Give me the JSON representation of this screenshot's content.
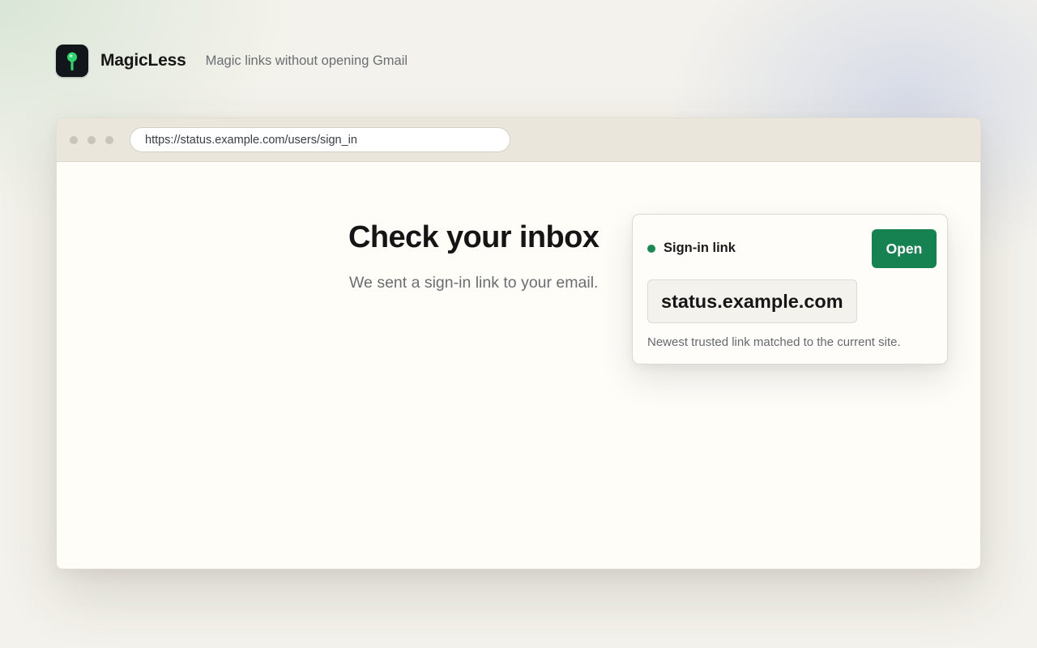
{
  "brand": {
    "name": "MagicLess",
    "tagline": "Magic links without opening Gmail",
    "icon": "key-icon",
    "accent_color": "#2fd470"
  },
  "browser": {
    "url": "https://status.example.com/users/sign_in",
    "window_controls": [
      "close",
      "minimize",
      "maximize"
    ]
  },
  "page": {
    "heading": "Check your inbox",
    "subtext": "We sent a sign-in link to your email."
  },
  "popup": {
    "label": "Sign-in link",
    "status_color": "#1a8a50",
    "open_label": "Open",
    "open_color": "#168251",
    "domain": "status.example.com",
    "note": "Newest trusted link matched to the current site."
  }
}
